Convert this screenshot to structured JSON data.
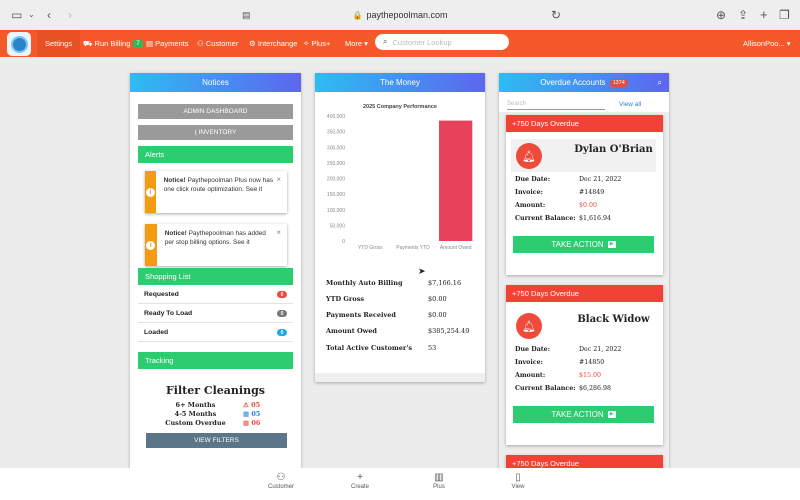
{
  "browser": {
    "url": "paythepoolman.com"
  },
  "nav": {
    "items": [
      "Settings",
      "Run Billing",
      "Payments",
      "Customer",
      "Interchange",
      "Plus+",
      "More"
    ],
    "run_billing_badge": "7",
    "search_placeholder": "Customer Lookup",
    "user": "AllisonPoo..."
  },
  "notices": {
    "title": "Notices",
    "admin_button": "ADMIN DASHBOARD",
    "inventory_button": "( INVENTORY",
    "alerts_title": "Alerts",
    "alerts": [
      {
        "bold": "Notice!",
        "text": " Paythepoolman Plus now has one click route optimization. See it"
      },
      {
        "bold": "Notice!",
        "text": " Paythepoolman has added per stop billing options. See it"
      }
    ],
    "shopping_title": "Shopping List",
    "shopping": [
      {
        "label": "Requested",
        "count": "0",
        "color": "#e74c3c"
      },
      {
        "label": "Ready To Load",
        "count": "0",
        "color": "#777777"
      },
      {
        "label": "Loaded",
        "count": "0",
        "color": "#1fa8e6"
      }
    ],
    "tracking_title": "Tracking",
    "filter_title": "Filter Cleanings",
    "filters": [
      {
        "label": "6+ Months",
        "value": "05",
        "icon": "warning-icon",
        "color": "#e74c3c"
      },
      {
        "label": "4-5 Months",
        "value": "05",
        "icon": "calendar-icon",
        "color": "#1f7fd0"
      },
      {
        "label": "Custom Overdue",
        "value": "06",
        "icon": "calendar-icon",
        "color": "#e74c3c"
      }
    ],
    "view_filters": "VIEW FILTERS"
  },
  "money": {
    "title": "The Money",
    "rows": [
      {
        "label": "Monthly Auto Billing",
        "value": "$7,166.16"
      },
      {
        "label": "YTD Gross",
        "value": "$0.00"
      },
      {
        "label": "Payments Received",
        "value": "$0.00"
      },
      {
        "label": "Amount Owed",
        "value": "$385,254.49"
      },
      {
        "label": "Total Active Customer's",
        "value": "53"
      }
    ]
  },
  "chart_data": {
    "type": "bar",
    "title": "2025 Company Performance",
    "categories": [
      "YTD Gross",
      "Payments YTD",
      "Amount Owed"
    ],
    "values": [
      0,
      0,
      385254.49
    ],
    "ylim": [
      0,
      400000
    ],
    "yticks": [
      "0",
      "50,000",
      "100,000",
      "150,000",
      "200,000",
      "250,000",
      "300,000",
      "350,000",
      "400,000"
    ],
    "bar_color": "#e8415c",
    "grid": false
  },
  "overdue": {
    "title": "Overdue Accounts",
    "count": "1374",
    "search_placeholder": "Search",
    "view_all": "View all",
    "take_action": "TAKE ACTION",
    "labels": {
      "due": "Due Date:",
      "invoice": "Invoice:",
      "amount": "Amount:",
      "balance": "Current Balance:"
    },
    "cards": [
      {
        "header": "+750 Days Overdue",
        "name": "Dylan O'Brian",
        "due": "Dec 21, 2022",
        "invoice": "#14849",
        "amount": "$0.00",
        "balance": "$1,616.94"
      },
      {
        "header": "+750 Days Overdue",
        "name": "Black Widow",
        "due": "Dec 21, 2022",
        "invoice": "#14850",
        "amount": "$15.00",
        "balance": "$6,286.98"
      },
      {
        "header": "+750 Days Overdue"
      }
    ]
  },
  "tabs": [
    {
      "label": "Customer",
      "icon": "users-icon"
    },
    {
      "label": "Create",
      "icon": "plus-icon"
    },
    {
      "label": "Plus",
      "icon": "map-icon"
    },
    {
      "label": "View",
      "icon": "book-icon"
    }
  ]
}
